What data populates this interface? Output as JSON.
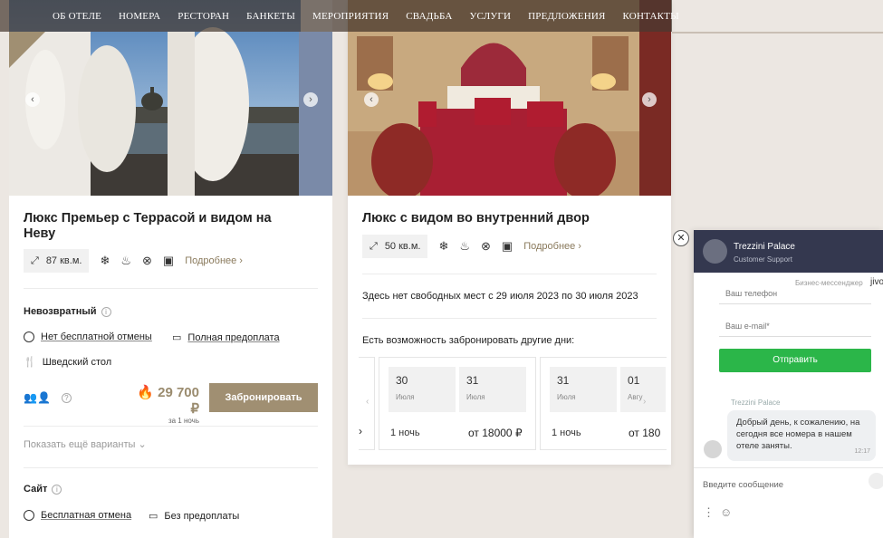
{
  "nav": {
    "items": [
      "ОБ ОТЕЛЕ",
      "НОМЕРА",
      "РЕСТОРАН",
      "БАНКЕТЫ",
      "МЕРОПРИЯТИЯ",
      "СВАДЬБА",
      "УСЛУГИ",
      "ПРЕДЛОЖЕНИЯ",
      "КОНТАКТЫ"
    ]
  },
  "room1": {
    "title": "Люкс Премьер с Террасой и видом на Неву",
    "area": "87 кв.м.",
    "details_link": "Подробнее",
    "tariff1": {
      "name": "Невозвратный",
      "cancel": "Нет бесплатной отмены",
      "prepay": "Полная предоплата",
      "meal": "Шведский стол",
      "price": "29 700 ₽",
      "price_sub": "за 1 ночь",
      "book_label": "Забронировать"
    },
    "show_more": "Показать ещё варианты",
    "tariff2": {
      "name": "Сайт",
      "cancel": "Бесплатная отмена",
      "prepay": "Без предоплаты"
    }
  },
  "room2": {
    "title": "Люкс с видом во внутренний двор",
    "area": "50 кв.м.",
    "details_link": "Подробнее",
    "no_rooms": "Здесь нет свободных мест с 29 июля 2023 по 30 июля 2023",
    "other_days": "Есть возможность забронировать другие дни:",
    "date_options": [
      {
        "from_day": "30",
        "from_month": "Июля",
        "to_day": "31",
        "to_month": "Июля",
        "nights": "1 ночь",
        "price": "от 18000 ₽"
      },
      {
        "from_day": "31",
        "from_month": "Июля",
        "to_day": "01",
        "to_month": "Авгу",
        "nights": "1 ночь",
        "price": "от 180"
      }
    ],
    "prev_nights_fragment": "›"
  },
  "chat": {
    "name": "Trezzini Palace",
    "subtitle": "Customer Support",
    "biz": "Бизнес-мессенджер",
    "brand": "jivo",
    "phone_placeholder": "Ваш телефон",
    "email_placeholder": "Ваш e-mail*",
    "send_label": "Отправить",
    "message_from": "Trezzini Palace",
    "message": "Добрый день, к сожалению, на сегодня все номера в нашем отеле заняты.",
    "message_time": "12:17",
    "input_placeholder": "Введите сообщение"
  },
  "colors": {
    "accent": "#a08f72",
    "send": "#2bb649",
    "chat_head": "#34384f"
  }
}
